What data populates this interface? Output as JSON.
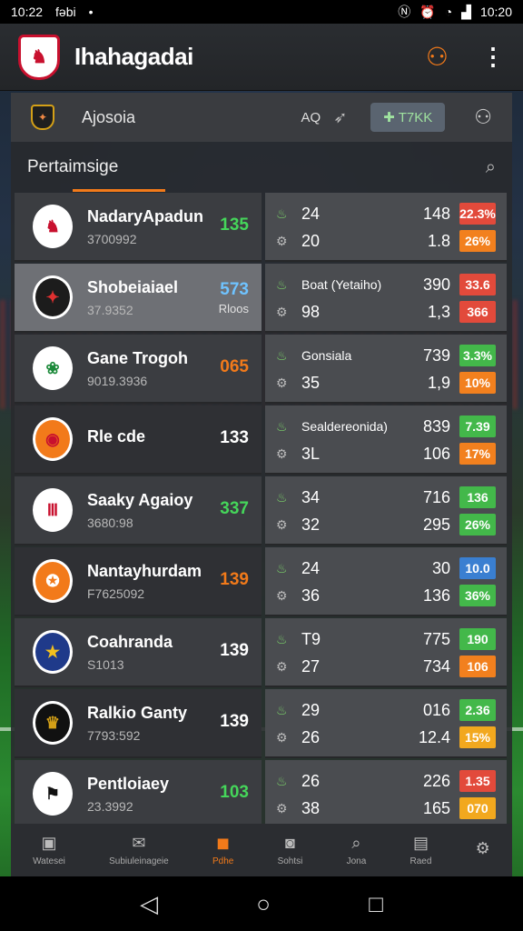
{
  "status_bar": {
    "time": "10:22",
    "carrier": "fəbi",
    "dot": "•",
    "icons": [
      "nfc-icon",
      "alarm-icon",
      "wifi-icon",
      "signal-icon"
    ],
    "clock_right": "10:20"
  },
  "app_bar": {
    "title": "Ihahagadai",
    "crest_glyph": "♞",
    "user_icon": "user-icon",
    "menu_icon": "kebab-icon"
  },
  "sub_header": {
    "title": "Ajosoia",
    "aq_label": "AQ",
    "follow_label": "✚ T7KK"
  },
  "panel": {
    "title": "Pertaimsige"
  },
  "rows": [
    {
      "team": "NadaryApadun",
      "sub": "3700992",
      "score": "135",
      "score_color": "#45d65a",
      "score_sub": "",
      "crest_bg": "#ffffff",
      "crest_fg": "#c8102e",
      "crest_glyph": "♞",
      "stat1_label": "24",
      "stat1_val": "148",
      "badge1": "22.3%",
      "badge1_color": "#e24a3b",
      "stat2_label": "20",
      "stat2_val": "1.8",
      "badge2": "26%",
      "badge2_color": "#f2801e"
    },
    {
      "team": "Shobeiaiael",
      "sub": "37.9352",
      "score": "573",
      "score_color": "#6fc3ff",
      "score_sub": "Rloos",
      "crest_bg": "#1c1c1c",
      "crest_fg": "#e03030",
      "crest_glyph": "✦",
      "stat1_label": "Boat (Yetaiho)",
      "stat1_small": true,
      "stat1_val": "390",
      "badge1": "33.6",
      "badge1_color": "#e24a3b",
      "stat2_label": "98",
      "stat2_val": "1,3",
      "badge2": "366",
      "badge2_color": "#e24a3b"
    },
    {
      "team": "Gane Trogoh",
      "sub": "9019.3936",
      "score": "065",
      "score_color": "#f27a1a",
      "score_sub": "",
      "crest_bg": "#ffffff",
      "crest_fg": "#1c8a3a",
      "crest_glyph": "❀",
      "stat1_label": "Gonsiala",
      "stat1_small": true,
      "stat1_val": "739",
      "badge1": "3.3%",
      "badge1_color": "#43b84a",
      "stat2_label": "35",
      "stat2_val": "1,9",
      "badge2": "10%",
      "badge2_color": "#f2801e"
    },
    {
      "team": "Rle cde",
      "sub": "",
      "score": "133",
      "score_color": "#ffffff",
      "score_sub": "",
      "crest_bg": "#f27a1a",
      "crest_fg": "#c8102e",
      "crest_glyph": "◉",
      "stat1_label": "Sealdereonida)",
      "stat1_small": true,
      "stat1_val": "839",
      "badge1": "7.39",
      "badge1_color": "#43b84a",
      "stat2_label": "3L",
      "stat2_val": "106",
      "badge2": "17%",
      "badge2_color": "#f2801e"
    },
    {
      "team": "Saaky Agaioy",
      "sub": "3680:98",
      "score": "337",
      "score_color": "#45d65a",
      "score_sub": "",
      "crest_bg": "#ffffff",
      "crest_fg": "#c8102e",
      "crest_glyph": "Ⅲ",
      "stat1_label": "34",
      "stat1_val": "716",
      "badge1": "136",
      "badge1_color": "#43b84a",
      "stat2_label": "32",
      "stat2_val": "295",
      "badge2": "26%",
      "badge2_color": "#43b84a"
    },
    {
      "team": "Nantayhurdam",
      "sub": "F7625092",
      "score": "139",
      "score_color": "#f27a1a",
      "score_sub": "",
      "crest_bg": "#f27a1a",
      "crest_fg": "#ffffff",
      "crest_glyph": "✪",
      "stat1_label": "24",
      "stat1_val": "30",
      "badge1": "10.0",
      "badge1_color": "#3a7fd1",
      "stat2_label": "36",
      "stat2_val": "136",
      "badge2": "36%",
      "badge2_color": "#43b84a"
    },
    {
      "team": "Coahranda",
      "sub": "S1013",
      "score": "139",
      "score_color": "#ffffff",
      "score_sub": "",
      "crest_bg": "#1f3a8a",
      "crest_fg": "#f2c01e",
      "crest_glyph": "★",
      "stat1_label": "T9",
      "stat1_val": "775",
      "badge1": "190",
      "badge1_color": "#43b84a",
      "stat2_label": "27",
      "stat2_val": "734",
      "badge2": "106",
      "badge2_color": "#f2801e"
    },
    {
      "team": "Ralkio Ganty",
      "sub": "7793:592",
      "score": "139",
      "score_color": "#ffffff",
      "score_sub": "",
      "crest_bg": "#111111",
      "crest_fg": "#d4a017",
      "crest_glyph": "♛",
      "stat1_label": "29",
      "stat1_val": "016",
      "badge1": "2.36",
      "badge1_color": "#43b84a",
      "stat2_label": "26",
      "stat2_val": "12.4",
      "badge2": "15%",
      "badge2_color": "#f2a81e"
    },
    {
      "team": "Pentloiaey",
      "sub": "23.3992",
      "score": "103",
      "score_color": "#45d65a",
      "score_sub": "",
      "crest_bg": "#ffffff",
      "crest_fg": "#111111",
      "crest_glyph": "⚑",
      "stat1_label": "26",
      "stat1_val": "226",
      "badge1": "1.35",
      "badge1_color": "#e24a3b",
      "stat2_label": "38",
      "stat2_val": "165",
      "badge2": "070",
      "badge2_color": "#f2a81e"
    }
  ],
  "bottom_nav": [
    {
      "label": "Watesei",
      "icon": "home-icon",
      "glyph": "▣",
      "active": false
    },
    {
      "label": "Subiuleinageie",
      "icon": "chat-icon",
      "glyph": "✉",
      "active": false
    },
    {
      "label": "Pdhe",
      "icon": "briefcase-icon",
      "glyph": "◼",
      "active": true
    },
    {
      "label": "Sohtsi",
      "icon": "teams-icon",
      "glyph": "◙",
      "active": false
    },
    {
      "label": "Jona",
      "icon": "search-icon",
      "glyph": "⌕",
      "active": false
    },
    {
      "label": "Raed",
      "icon": "document-icon",
      "glyph": "▤",
      "active": false
    },
    {
      "label": "",
      "icon": "settings-icon",
      "glyph": "⚙",
      "active": false
    }
  ],
  "system_nav": {
    "back": "◁",
    "home": "○",
    "recents": "□"
  }
}
